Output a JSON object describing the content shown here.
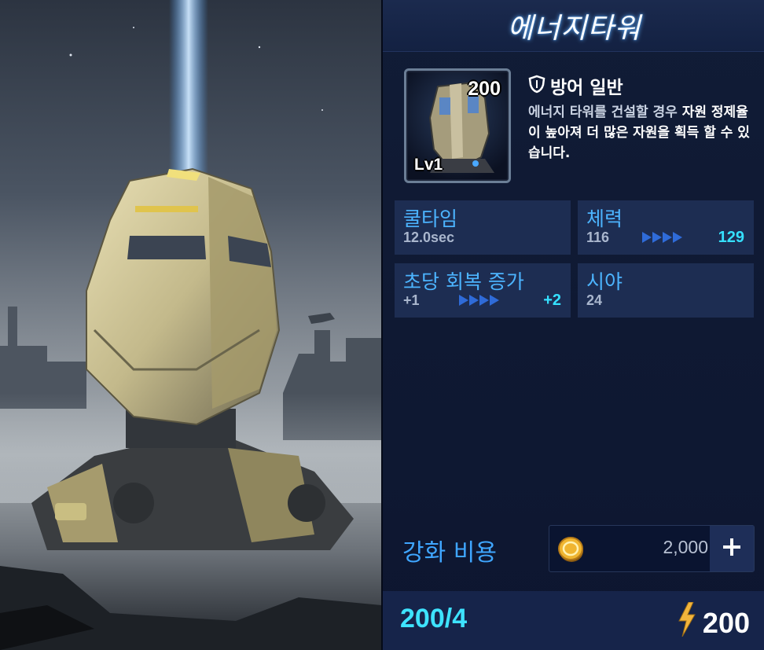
{
  "unit": {
    "name": "에너지타워",
    "cost": "200",
    "level": "Lv1",
    "type": "방어 일반",
    "description_pre": "에너지 타워를 건설할 경우 ",
    "description_highlight": "자원 정제율이 높아져 더 많은 자원을 획득 할 수 있습니다."
  },
  "stats": {
    "cooldown": {
      "label": "쿨타임",
      "value": "12.0sec"
    },
    "health": {
      "label": "체력",
      "current": "116",
      "next": "129"
    },
    "regen": {
      "label": "초당 회복 증가",
      "current": "+1",
      "next": "+2"
    },
    "sight": {
      "label": "시야",
      "value": "24"
    }
  },
  "upgrade": {
    "label": "강화 비용",
    "cost": "2,000"
  },
  "footer": {
    "supply_current": "200",
    "supply_separator": "/",
    "supply_max": "4",
    "energy": "200"
  },
  "icons": {
    "shield": "shield-icon",
    "coin": "gold-coin-icon",
    "plus": "plus-icon",
    "bolt": "lightning-bolt-icon"
  },
  "colors": {
    "accent_blue": "#4cb4ff",
    "accent_cyan": "#35e0ff",
    "panel_bg": "#111c36",
    "stat_bg": "#1d2d52"
  }
}
